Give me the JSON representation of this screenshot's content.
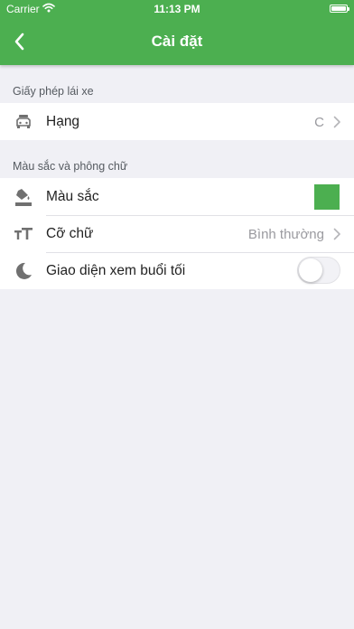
{
  "status_bar": {
    "carrier": "Carrier",
    "time": "11:13 PM"
  },
  "nav": {
    "title": "Cài đặt",
    "back_icon": "chevron-left-icon"
  },
  "sections": [
    {
      "header": "Giấy phép lái xe",
      "rows": [
        {
          "label": "Hạng",
          "value": "C",
          "icon": "car-icon"
        }
      ]
    },
    {
      "header": "Màu sắc và phông chữ",
      "rows": [
        {
          "label": "Màu sắc",
          "icon": "paint-bucket-icon",
          "swatch_color": "#4caf50"
        },
        {
          "label": "Cỡ chữ",
          "value": "Bình thường",
          "icon": "text-size-icon"
        },
        {
          "label": "Giao diện xem buổi tối",
          "icon": "moon-icon",
          "toggle_on": false
        }
      ]
    }
  ],
  "colors": {
    "accent": "#4caf50",
    "background": "#f0f0f5"
  }
}
